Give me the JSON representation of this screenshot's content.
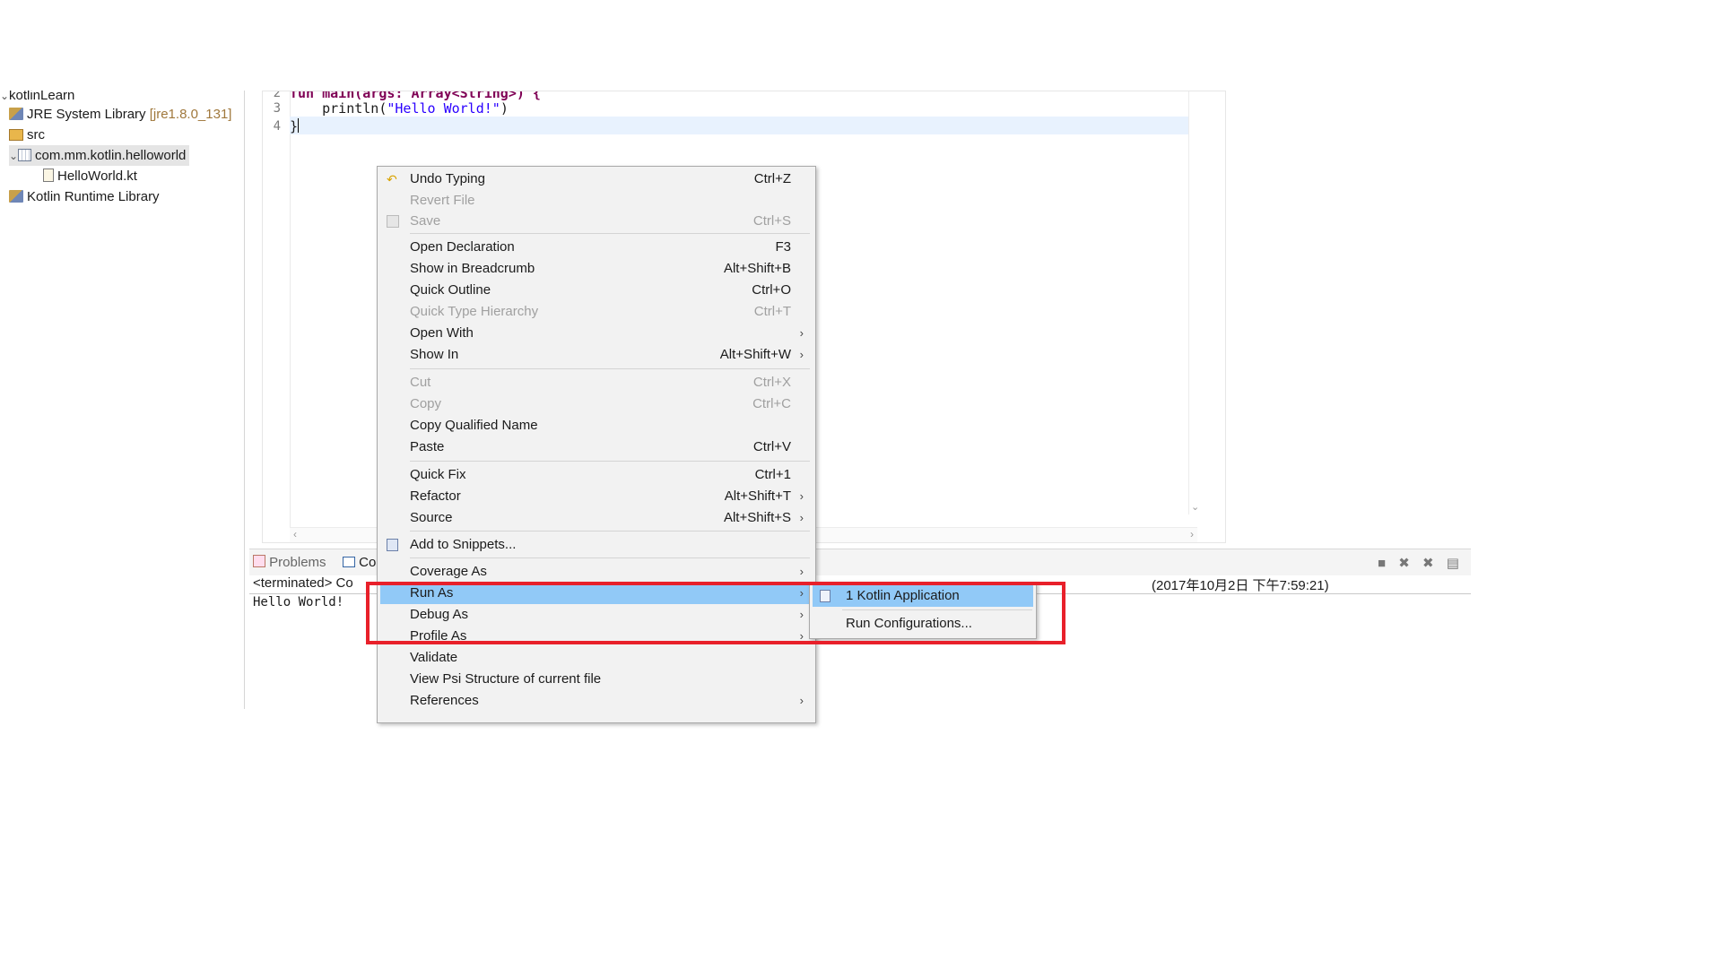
{
  "explorer": {
    "project": "kotlinLearn",
    "jre_label": "JRE System Library",
    "jre_version": "[jre1.8.0_131]",
    "src": "src",
    "package": "com.mm.kotlin.helloworld",
    "file": "HelloWorld.kt",
    "kotlin_runtime": "Kotlin Runtime Library"
  },
  "editor": {
    "lines": [
      {
        "num": "2",
        "text": "fun main(args: Array<String>) {"
      },
      {
        "num": "3",
        "prefix": "    println(",
        "string": "\"Hello World!\"",
        "suffix": ")"
      },
      {
        "num": "4",
        "text": "}"
      }
    ]
  },
  "panel": {
    "tab_problems": "Problems",
    "tab_console": "Co",
    "terminated_prefix": "<terminated> Co",
    "terminated_suffix": "(2017年10月2日 下午7:59:21)",
    "output": "Hello World!"
  },
  "context_menu": {
    "items": [
      {
        "label": "Undo Typing",
        "shortcut": "Ctrl+Z",
        "icon": "undo-icon"
      },
      {
        "label": "Revert File",
        "disabled": true
      },
      {
        "label": "Save",
        "shortcut": "Ctrl+S",
        "disabled": true,
        "icon": "save-icon"
      },
      {
        "label": "Open Declaration",
        "shortcut": "F3"
      },
      {
        "label": "Show in Breadcrumb",
        "shortcut": "Alt+Shift+B"
      },
      {
        "label": "Quick Outline",
        "shortcut": "Ctrl+O"
      },
      {
        "label": "Quick Type Hierarchy",
        "shortcut": "Ctrl+T",
        "disabled": true
      },
      {
        "label": "Open With"
      },
      {
        "label": "Show In",
        "shortcut": "Alt+Shift+W"
      },
      {
        "label": "Cut",
        "shortcut": "Ctrl+X",
        "disabled": true
      },
      {
        "label": "Copy",
        "shortcut": "Ctrl+C",
        "disabled": true
      },
      {
        "label": "Copy Qualified Name"
      },
      {
        "label": "Paste",
        "shortcut": "Ctrl+V"
      },
      {
        "label": "Quick Fix",
        "shortcut": "Ctrl+1"
      },
      {
        "label": "Refactor",
        "shortcut": "Alt+Shift+T"
      },
      {
        "label": "Source",
        "shortcut": "Alt+Shift+S"
      },
      {
        "label": "Add to Snippets...",
        "icon": "snippets-icon"
      },
      {
        "label": "Coverage As"
      },
      {
        "label": "Run As",
        "highlighted": true
      },
      {
        "label": "Debug As"
      },
      {
        "label": "Profile As"
      },
      {
        "label": "Validate"
      },
      {
        "label": "View Psi Structure of current file"
      },
      {
        "label": "References"
      }
    ],
    "submenu": [
      {
        "label": "1 Kotlin Application",
        "highlighted": true,
        "icon": "kotlin-app-icon"
      },
      {
        "label": "Run Configurations..."
      }
    ]
  },
  "colors": {
    "highlight": "#91c9f7",
    "annotation_box": "#e8202a",
    "keyword": "#7f0055",
    "string": "#2a00ff"
  }
}
